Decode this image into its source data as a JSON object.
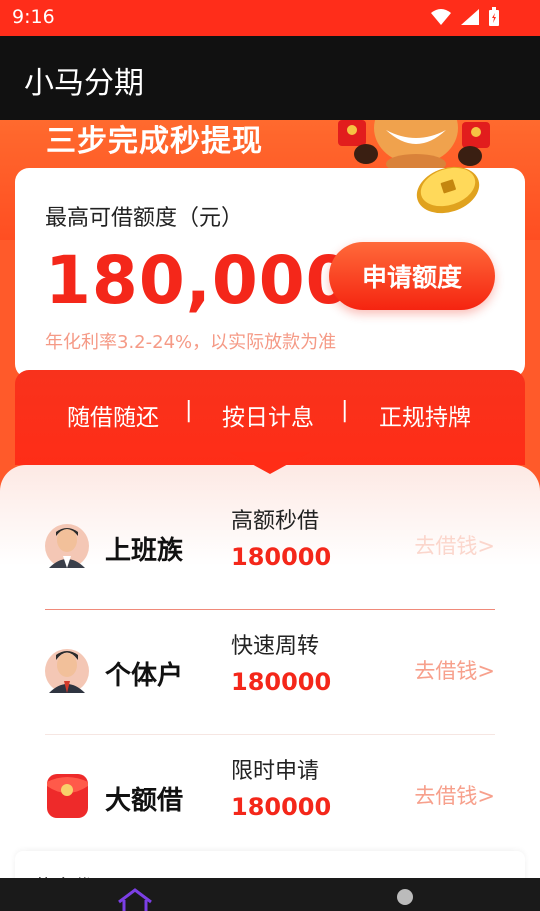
{
  "status_bar": {
    "time": "9:16"
  },
  "app_bar": {
    "title": "小马分期"
  },
  "hero": {
    "title": "三步完成秒提现"
  },
  "quota_card": {
    "label": "最高可借额度（元）",
    "amount": "180,000",
    "apply_label": "申请额度",
    "note": "年化利率3.2-24%，以实际放款为准"
  },
  "features": {
    "items": [
      "随借随还",
      "按日计息",
      "正规持牌"
    ],
    "separator": "|"
  },
  "loans": [
    {
      "name": "上班族",
      "subtitle": "高额秒借",
      "amount": "180000",
      "link": "去借钱>",
      "icon": "office-worker-avatar-icon"
    },
    {
      "name": "个体户",
      "subtitle": "快速周转",
      "amount": "180000",
      "link": "去借钱>",
      "icon": "business-owner-avatar-icon"
    },
    {
      "name": "大额借",
      "subtitle": "限时申请",
      "amount": "180000",
      "link": "去借钱>",
      "icon": "red-envelope-icon"
    }
  ],
  "next_card": {
    "title": "黄金代"
  },
  "colors": {
    "brand_red": "#f4271a",
    "hero_orange": "#ff5a2a",
    "status_red": "#ff2d1a"
  }
}
